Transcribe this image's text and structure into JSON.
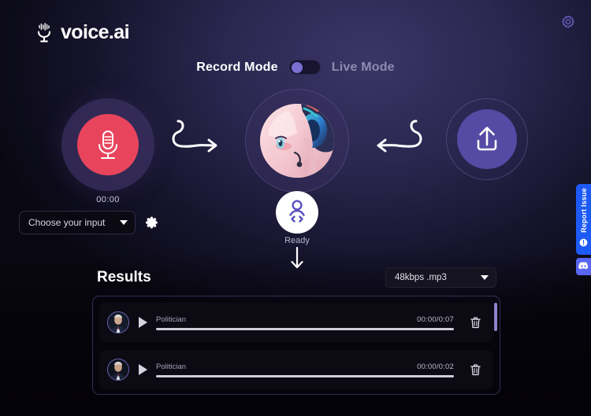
{
  "app": {
    "brand": "voice.ai",
    "logo_icon": "microphone-waveform-icon",
    "settings_icon": "gear-icon"
  },
  "mode_toggle": {
    "left_label": "Record Mode",
    "right_label": "Live Mode",
    "active": "Record Mode",
    "knob_position": "left",
    "knob_color": "#7b6fd4"
  },
  "stage": {
    "record": {
      "icon": "microphone-icon",
      "button_color": "#e8455c",
      "halo_color": "#3d3265",
      "timer": "00:00"
    },
    "arrow_to_center": "curved-arrow-right-icon",
    "arrow_from_upload": "curved-arrow-left-icon",
    "voice_avatar": {
      "icon": "anime-avatar-image",
      "halo_color": "#3a3060"
    },
    "status_badge": {
      "icon": "voice-profile-code-icon",
      "label": "Ready",
      "badge_bg": "#ffffff",
      "icon_color": "#5a4fbd"
    },
    "flow_arrow_down": "arrow-down-icon",
    "upload": {
      "icon": "upload-icon",
      "button_color": "#564aa4",
      "halo_color": "#2f2854"
    }
  },
  "input_bar": {
    "select_value": "Choose your input",
    "caret_icon": "chevron-down-icon",
    "settings_icon": "gear-icon"
  },
  "results": {
    "title": "Results",
    "format": {
      "value": "48kbps .mp3",
      "caret_icon": "chevron-down-icon"
    },
    "rows": [
      {
        "avatar_icon": "politician-portrait-avatar",
        "play_icon": "play-icon",
        "name": "Politician",
        "time": "00:00/0:07",
        "progress": 100,
        "delete_icon": "trash-icon"
      },
      {
        "avatar_icon": "politician-portrait-avatar",
        "play_icon": "play-icon",
        "name": "Politician",
        "time": "00:00/0:02",
        "progress": 100,
        "delete_icon": "trash-icon"
      }
    ]
  },
  "side_rail": {
    "report": {
      "label": "Report Issue",
      "icon": "info-circle-icon",
      "color": "#1d5af5"
    },
    "discord": {
      "icon": "discord-icon",
      "color": "#5865f2"
    }
  }
}
